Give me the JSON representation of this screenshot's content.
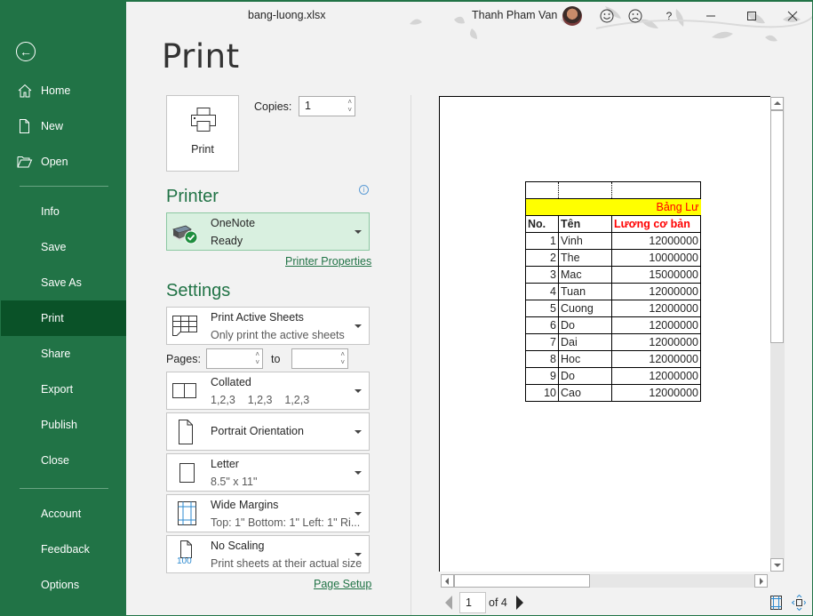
{
  "window": {
    "title": "bang-luong.xlsx",
    "user_name": "Thanh Pham Van",
    "accent": "#217346",
    "help_label": "?"
  },
  "sidebar": {
    "back_label": "←",
    "items": [
      {
        "label": "Home",
        "icon": "home-icon"
      },
      {
        "label": "New",
        "icon": "new-document-icon"
      },
      {
        "label": "Open",
        "icon": "folder-open-icon"
      },
      {
        "label": "Info"
      },
      {
        "label": "Save"
      },
      {
        "label": "Save As"
      },
      {
        "label": "Print",
        "active": true
      },
      {
        "label": "Share"
      },
      {
        "label": "Export"
      },
      {
        "label": "Publish"
      },
      {
        "label": "Close"
      },
      {
        "label": "Account"
      },
      {
        "label": "Feedback"
      },
      {
        "label": "Options"
      }
    ]
  },
  "print": {
    "page_title": "Print",
    "print_button_label": "Print",
    "copies_label": "Copies:",
    "copies_value": "1",
    "printer_header": "Printer",
    "printer": {
      "name": "OneNote",
      "status": "Ready"
    },
    "printer_properties_link": "Printer Properties",
    "settings_header": "Settings",
    "settings": {
      "what": {
        "title": "Print Active Sheets",
        "subtitle": "Only print the active sheets"
      },
      "pages_label": "Pages:",
      "pages_from": "",
      "to_label": "to",
      "pages_to": "",
      "collation": {
        "title": "Collated",
        "subtitle": "1,2,3    1,2,3    1,2,3"
      },
      "orientation": {
        "title": "Portrait Orientation"
      },
      "paper": {
        "title": "Letter",
        "subtitle": "8.5\" x 11\""
      },
      "margins": {
        "title": "Wide Margins",
        "subtitle": "Top: 1\" Bottom: 1\" Left: 1\" Ri..."
      },
      "scaling": {
        "title": "No Scaling",
        "subtitle": "Print sheets at their actual size",
        "icon_text": "100"
      }
    },
    "page_setup_link": "Page Setup"
  },
  "preview": {
    "banner_text": "Bảng Lư",
    "headers": [
      "No.",
      "Tên",
      "Lương cơ bản"
    ],
    "rows": [
      [
        "1",
        "Vinh",
        "12000000"
      ],
      [
        "2",
        "The",
        "10000000"
      ],
      [
        "3",
        "Mac",
        "15000000"
      ],
      [
        "4",
        "Tuan",
        "12000000"
      ],
      [
        "5",
        "Cuong",
        "12000000"
      ],
      [
        "6",
        "Do",
        "12000000"
      ],
      [
        "7",
        "Dai",
        "12000000"
      ],
      [
        "8",
        "Hoc",
        "12000000"
      ],
      [
        "9",
        "Do",
        "12000000"
      ],
      [
        "10",
        "Cao",
        "12000000"
      ]
    ],
    "current_page": "1",
    "of_label": "of 4"
  }
}
